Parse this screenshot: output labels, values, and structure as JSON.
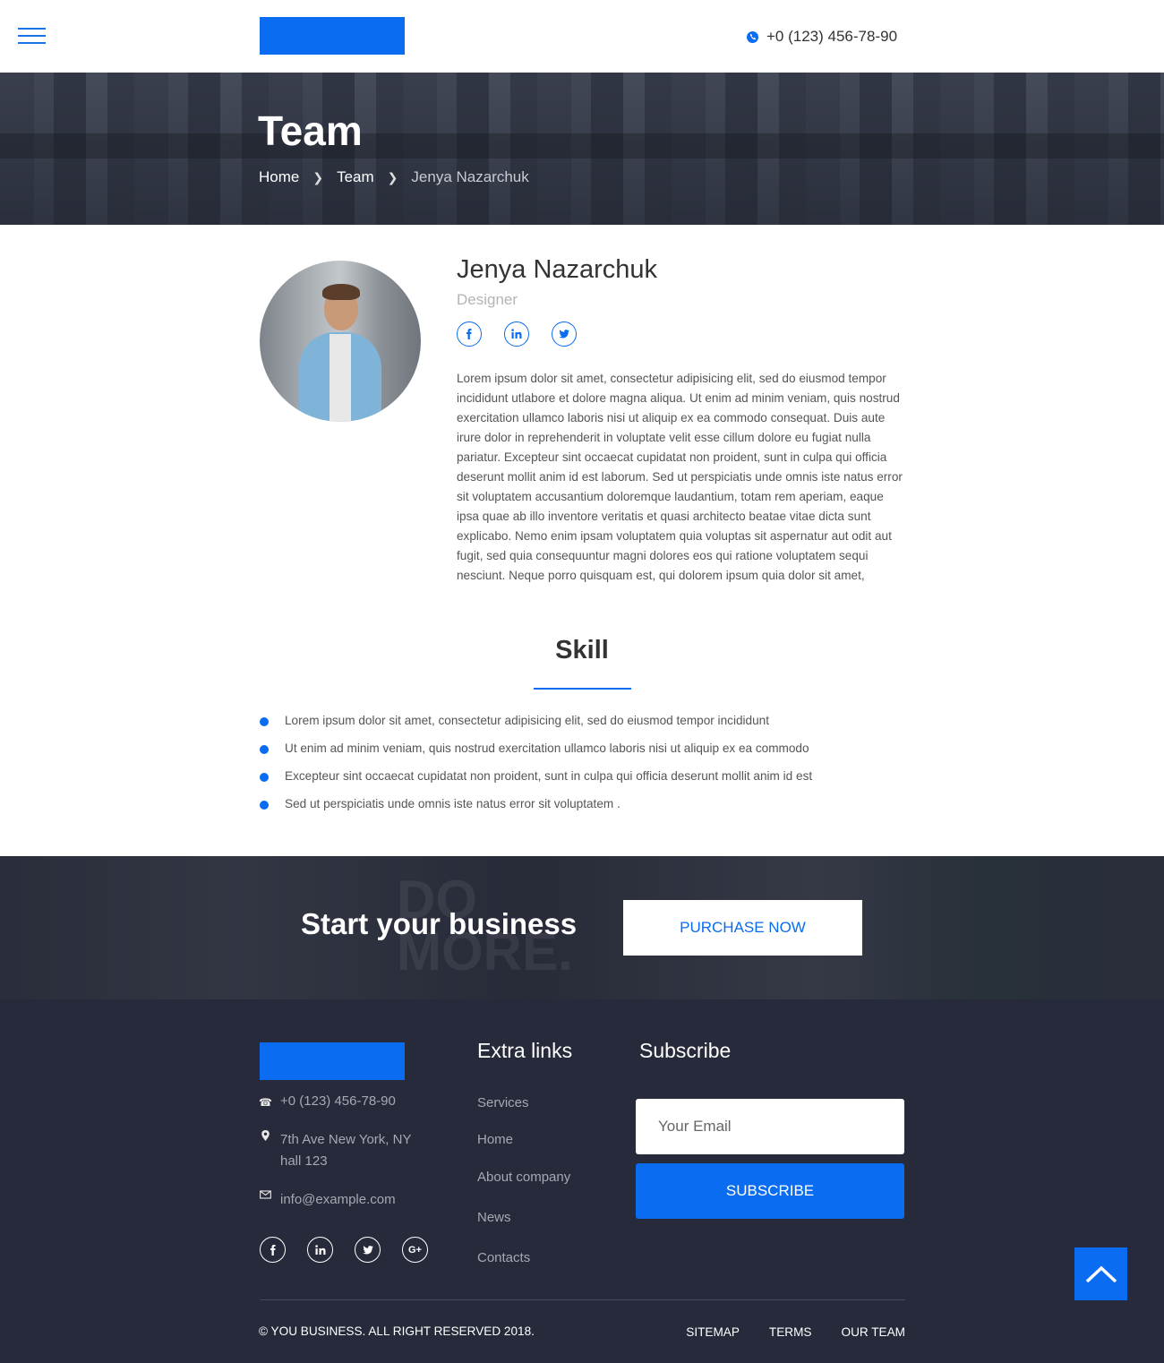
{
  "header": {
    "phone": "+0 (123) 456-78-90"
  },
  "hero": {
    "title": "Team",
    "breadcrumb": [
      {
        "label": "Home"
      },
      {
        "label": "Team"
      },
      {
        "label": "Jenya Nazarchuk"
      }
    ]
  },
  "profile": {
    "name": "Jenya Nazarchuk",
    "role": "Designer",
    "social": [
      "facebook-icon",
      "linkedin-icon",
      "twitter-icon"
    ],
    "bio": "Lorem ipsum dolor sit amet, consectetur adipisicing elit, sed do eiusmod tempor incididunt utlabore et dolore magna aliqua. Ut enim ad minim veniam, quis nostrud exercitation ullamco laboris nisi ut aliquip ex ea commodo consequat. Duis aute irure dolor in reprehenderit in voluptate velit esse cillum dolore eu fugiat nulla pariatur. Excepteur sint occaecat cupidatat non proident, sunt in culpa qui officia deserunt mollit anim id est laborum. Sed ut perspiciatis unde omnis iste natus error sit voluptatem accusantium doloremque laudantium, totam rem aperiam, eaque ipsa quae ab illo inventore veritatis et quasi architecto beatae vitae dicta sunt explicabo. Nemo enim ipsam voluptatem quia voluptas sit aspernatur aut odit aut fugit, sed quia consequuntur magni dolores eos qui ratione voluptatem sequi nesciunt. Neque porro quisquam est, qui dolorem ipsum quia dolor sit amet,"
  },
  "skill": {
    "title": "Skill",
    "items": [
      "Lorem ipsum dolor sit amet, consectetur adipisicing elit, sed do eiusmod tempor incididunt",
      "Ut enim ad minim veniam, quis nostrud exercitation ullamco laboris nisi ut aliquip ex ea commodo",
      "Excepteur sint occaecat cupidatat non proident, sunt in culpa qui officia deserunt mollit anim id est",
      "Sed ut perspiciatis unde omnis iste natus error sit voluptatem ."
    ]
  },
  "cta": {
    "title": "Start your business",
    "button": "PURCHASE NOW",
    "background_text_1": "DO",
    "background_text_2": "MORE."
  },
  "footer": {
    "phone": "+0 (123) 456-78-90",
    "address_line1": "7th Ave New York, NY",
    "address_line2": "hall 123",
    "email": "info@example.com",
    "social": [
      "facebook-icon",
      "linkedin-icon",
      "twitter-icon",
      "google-plus-icon"
    ],
    "extra_links_title": "Extra links",
    "extra_links": [
      "Services",
      "Home",
      "About company",
      "News",
      "Contacts"
    ],
    "subscribe_title": "Subscribe",
    "email_placeholder": "Your Email",
    "subscribe_button": "SUBSCRIBE",
    "copyright": "© YOU BUSINESS. ALL RIGHT RESERVED 2018.",
    "bottom_links": [
      "SITEMAP",
      "TERMS",
      "OUR TEAM"
    ]
  },
  "colors": {
    "accent": "#0a6cf0",
    "footer_bg": "#262a3a",
    "hero_overlay": "#282c3a"
  }
}
